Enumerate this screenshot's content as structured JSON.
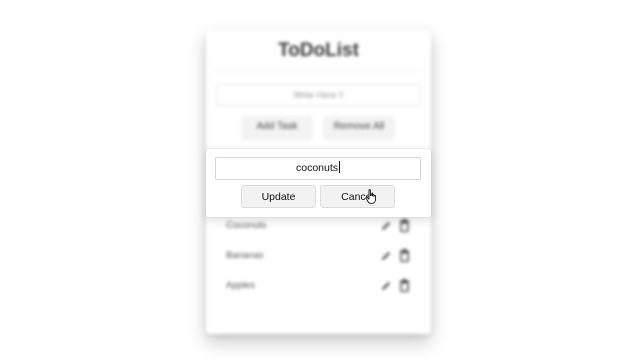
{
  "app": {
    "title": "ToDoList",
    "input_placeholder": "Write Here !!",
    "add_label": "Add Task",
    "remove_label": "Remove All"
  },
  "tasks": [
    {
      "label": "Coconuts"
    },
    {
      "label": "Bananas"
    },
    {
      "label": "Apples"
    }
  ],
  "edit_dialog": {
    "input_value": "coconuts",
    "update_label": "Update",
    "cancel_label": "Cancel"
  },
  "icons": {
    "edit": "pencil-icon",
    "delete": "trash-icon",
    "cursor": "hand-pointer-icon"
  },
  "colors": {
    "icon": "#3b3b3b",
    "button_bg": "#f2f2f2",
    "title": "#3a3a3a"
  }
}
